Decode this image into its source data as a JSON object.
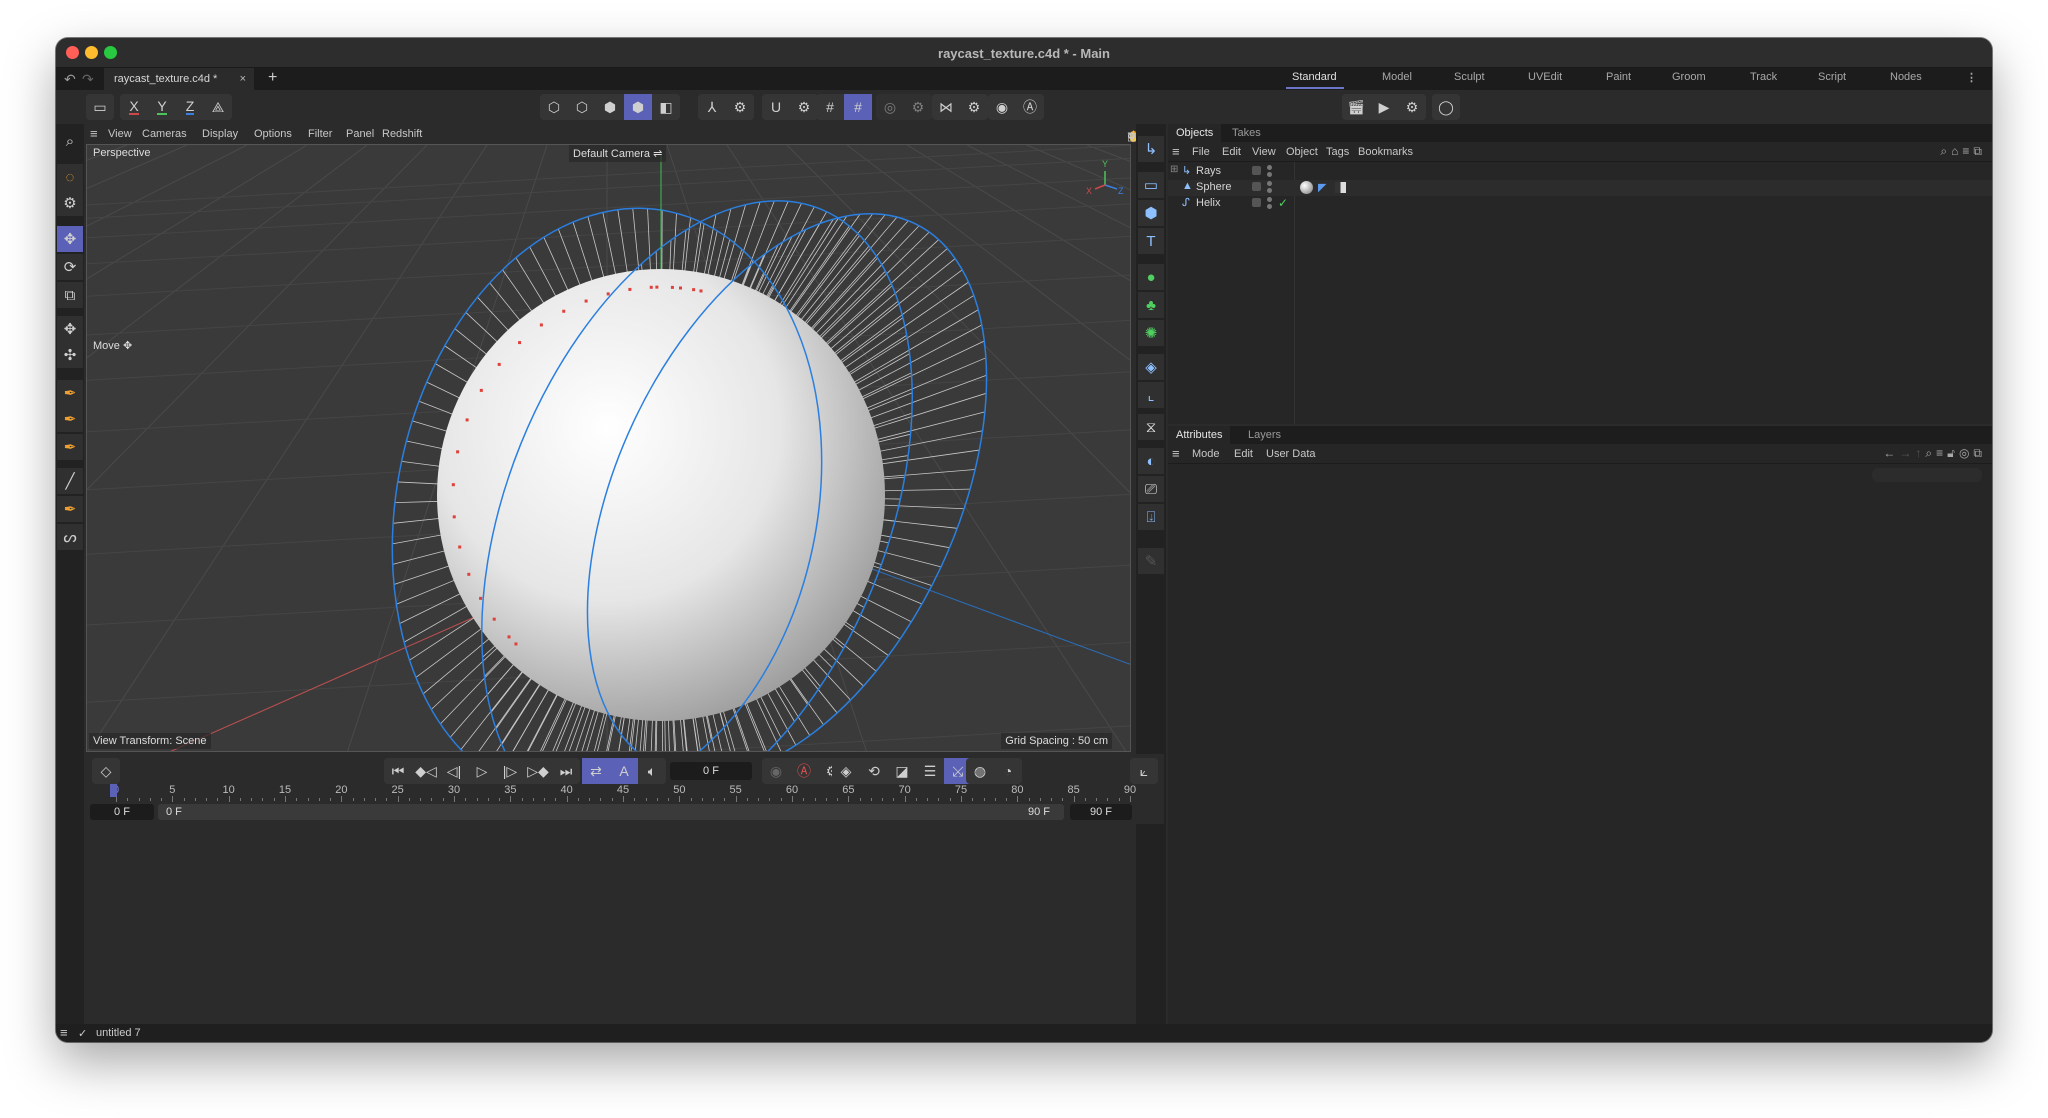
{
  "window": {
    "title": "raycast_texture.c4d * - Main",
    "traffic_colors": {
      "close": "#ff5f57",
      "minimize": "#febc2e",
      "zoom": "#28c840"
    }
  },
  "tabbar": {
    "undo_icon": "undo-icon",
    "redo_icon": "redo-icon",
    "document_tab": "raycast_texture.c4d *",
    "close_symbol": "×",
    "new_tab_symbol": "+"
  },
  "layouts": [
    {
      "label": "Standard",
      "active": true
    },
    {
      "label": "Model"
    },
    {
      "label": "Sculpt"
    },
    {
      "label": "UVEdit"
    },
    {
      "label": "Paint"
    },
    {
      "label": "Groom"
    },
    {
      "label": "Track"
    },
    {
      "label": "Script"
    },
    {
      "label": "Nodes"
    }
  ],
  "toolbar": {
    "axis_x": "X",
    "axis_y": "Y",
    "axis_z": "Z"
  },
  "viewport_menu": [
    "View",
    "Cameras",
    "Display",
    "Options",
    "Filter",
    "Panel",
    "Redshift"
  ],
  "viewport": {
    "projection": "Perspective",
    "camera": "Default Camera",
    "tool_hint": "Move",
    "view_transform": "View Transform: Scene",
    "grid_spacing": "Grid Spacing : 50 cm",
    "axis_labels": {
      "x": "X",
      "y": "Y",
      "z": "Z"
    },
    "colors": {
      "background": "#3a3a3a",
      "sphere": "#e8e8e8",
      "helix": "#2a7fe0",
      "hit_points": "#e0403a",
      "rays": "#c8c8c8"
    }
  },
  "objects_panel": {
    "tabs": [
      {
        "label": "Objects",
        "active": true
      },
      {
        "label": "Takes"
      }
    ],
    "menu": [
      "File",
      "Edit",
      "View",
      "Object",
      "Tags",
      "Bookmarks"
    ],
    "objects": [
      {
        "name": "Rays",
        "icon": "rays-object-icon",
        "expandable": true
      },
      {
        "name": "Sphere",
        "icon": "sphere-object-icon",
        "tags": [
          "material-tag",
          "texture-tag",
          "checker-tag"
        ]
      },
      {
        "name": "Helix",
        "icon": "helix-spline-icon",
        "enabled_check": true
      }
    ]
  },
  "attributes_panel": {
    "tabs": [
      {
        "label": "Attributes",
        "active": true
      },
      {
        "label": "Layers"
      }
    ],
    "menu": [
      "Mode",
      "Edit",
      "User Data"
    ]
  },
  "timeline": {
    "current_frame": "0 F",
    "start_field": "0 F",
    "range_start": "0 F",
    "range_end": "90 F",
    "end_field": "90 F",
    "ruler_ticks": [
      "0",
      "5",
      "10",
      "15",
      "20",
      "25",
      "30",
      "35",
      "40",
      "45",
      "50",
      "55",
      "60",
      "65",
      "70",
      "75",
      "80",
      "85",
      "90"
    ],
    "min_frame": 0,
    "max_frame": 90,
    "playhead_frame": 0
  },
  "statusbar": {
    "text": "untitled 7"
  }
}
